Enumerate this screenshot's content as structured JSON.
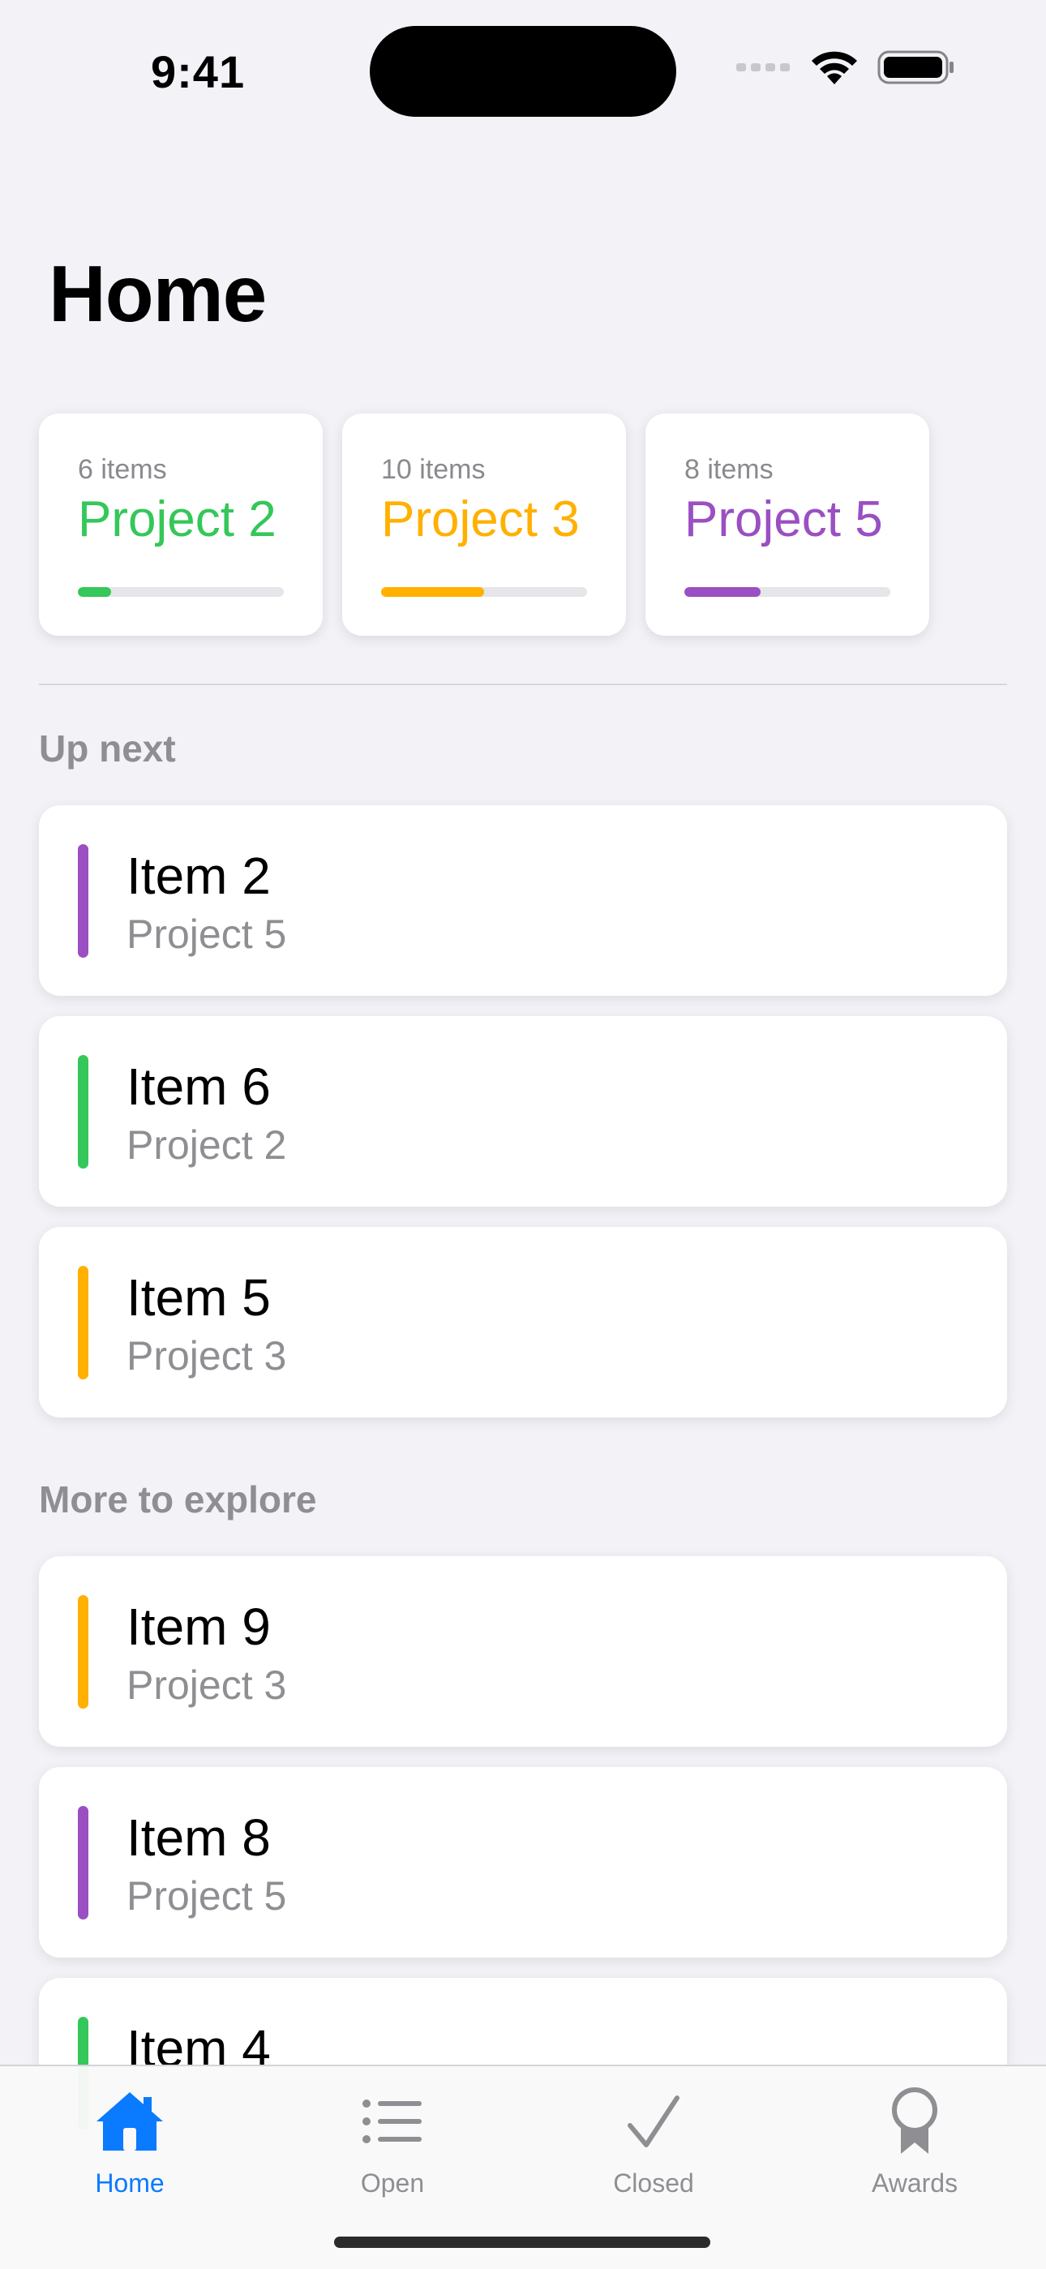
{
  "status_bar": {
    "time": "9:41"
  },
  "header": {
    "title": "Home"
  },
  "projects": [
    {
      "count_label": "6 items",
      "name": "Project 2",
      "color": "#34c759",
      "progress": 0.16
    },
    {
      "count_label": "10 items",
      "name": "Project 3",
      "color": "#ffb000",
      "progress": 0.5
    },
    {
      "count_label": "8 items",
      "name": "Project 5",
      "color": "#9a4fc2",
      "progress": 0.37
    }
  ],
  "up_next": {
    "title": "Up next",
    "items": [
      {
        "title": "Item 2",
        "project": "Project 5",
        "color": "#9a4fc2"
      },
      {
        "title": "Item 6",
        "project": "Project 2",
        "color": "#34c759"
      },
      {
        "title": "Item 5",
        "project": "Project 3",
        "color": "#ffb000"
      }
    ]
  },
  "more_to_explore": {
    "title": "More to explore",
    "items": [
      {
        "title": "Item 9",
        "project": "Project 3",
        "color": "#ffb000"
      },
      {
        "title": "Item 8",
        "project": "Project 5",
        "color": "#9a4fc2"
      },
      {
        "title": "Item 4",
        "project": "",
        "color": "#34c759"
      }
    ]
  },
  "tab_bar": {
    "tabs": [
      {
        "label": "Home",
        "icon": "house-fill-icon",
        "active": true
      },
      {
        "label": "Open",
        "icon": "list-bullet-icon",
        "active": false
      },
      {
        "label": "Closed",
        "icon": "checkmark-icon",
        "active": false
      },
      {
        "label": "Awards",
        "icon": "rosette-icon",
        "active": false
      }
    ],
    "active_color": "#0a7aff",
    "inactive_color": "#8e8e93"
  }
}
